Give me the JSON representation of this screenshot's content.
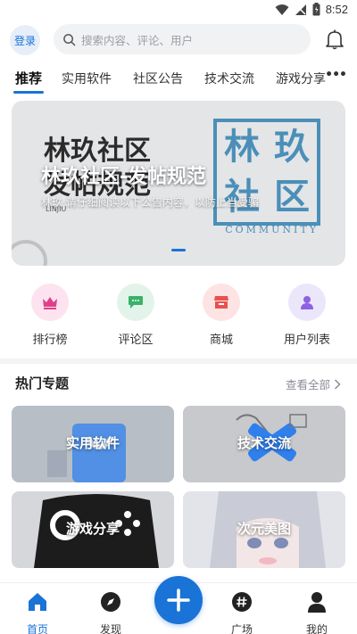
{
  "status_bar": {
    "time": "8:52"
  },
  "header": {
    "login_label": "登录",
    "search_placeholder": "搜索内容、评论、用户"
  },
  "tabs": [
    {
      "label": "推荐",
      "active": true
    },
    {
      "label": "实用软件"
    },
    {
      "label": "社区公告"
    },
    {
      "label": "技术交流"
    },
    {
      "label": "游戏分享"
    }
  ],
  "banner": {
    "title": "林玖社区-发帖规范",
    "subtitle": "林玖·请仔细阅读以下公告内容，以防上当受骗",
    "bg_text_line1": "林玖社区",
    "bg_text_line2": "发帖规范",
    "bg_small": "LINJIU",
    "stamp_chars": [
      "林",
      "玖",
      "社",
      "区"
    ],
    "stamp_word": "COMMUNITY",
    "stamp_color": "#4b8fb8"
  },
  "quick_entries": [
    {
      "label": "排行榜",
      "icon": "crown-icon",
      "bg": "#fde3ef",
      "color": "#e0408a"
    },
    {
      "label": "评论区",
      "icon": "comment-icon",
      "bg": "#e2f4ea",
      "color": "#38b26a"
    },
    {
      "label": "商城",
      "icon": "store-icon",
      "bg": "#fde3e3",
      "color": "#e6524f"
    },
    {
      "label": "用户列表",
      "icon": "user-icon",
      "bg": "#ece6fb",
      "color": "#8c63e0"
    }
  ],
  "hot_topics": {
    "title": "热门专题",
    "view_all": "查看全部",
    "items": [
      {
        "label": "实用软件"
      },
      {
        "label": "技术交流"
      },
      {
        "label": "游戏分享"
      },
      {
        "label": "次元美图"
      }
    ]
  },
  "bottom_nav": [
    {
      "label": "首页",
      "icon": "home-icon",
      "active": true
    },
    {
      "label": "发现",
      "icon": "compass-icon"
    },
    {
      "label": "广场",
      "icon": "hashtag-icon"
    },
    {
      "label": "我的",
      "icon": "profile-icon"
    }
  ],
  "colors": {
    "accent": "#1a73d6"
  }
}
